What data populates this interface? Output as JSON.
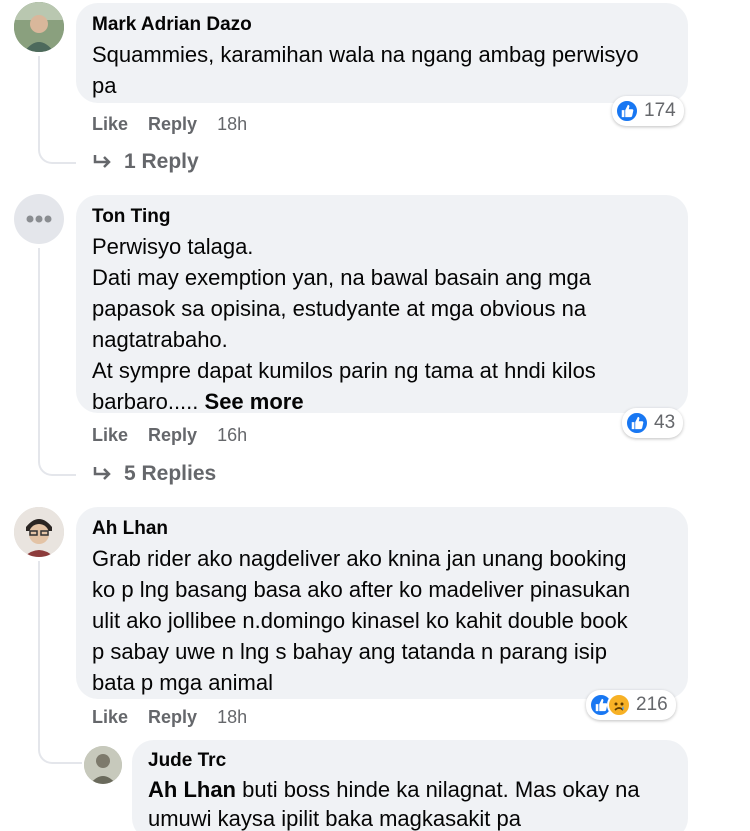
{
  "comments": [
    {
      "author": "Mark Adrian Dazo",
      "text": "Squammies, karamihan wala na ngang ambag perwisyo\npa",
      "reactions": {
        "icons": [
          "like-icon"
        ],
        "count": "174"
      },
      "actions": {
        "like": "Like",
        "reply": "Reply",
        "time": "18h"
      },
      "replies_label": "1 Reply"
    },
    {
      "author": "Ton Ting",
      "text": "Perwisyo talaga.\nDati may exemption yan, na bawal basain ang mga\npapasok sa opisina, estudyante at mga obvious na\nnagtatrabaho.\nAt sympre dapat kumilos parin ng tama at hndi kilos\nbarbaro..... ",
      "see_more": "See more",
      "reactions": {
        "icons": [
          "like-icon"
        ],
        "count": "43"
      },
      "actions": {
        "like": "Like",
        "reply": "Reply",
        "time": "16h"
      },
      "replies_label": "5 Replies"
    },
    {
      "author": "Ah Lhan",
      "text": "Grab rider ako nagdeliver ako knina jan unang booking\nko p lng basang basa ako after ko madeliver pinasukan\nulit ako jollibee n.domingo kinasel ko kahit double book\np sabay uwe n lng s bahay ang tatanda n parang isip\nbata p mga animal",
      "reactions": {
        "icons": [
          "like-icon",
          "sad-icon"
        ],
        "count": "216"
      },
      "actions": {
        "like": "Like",
        "reply": "Reply",
        "time": "18h"
      }
    }
  ],
  "reply": {
    "author": "Jude Trc",
    "mention": "Ah Lhan",
    "text": " buti boss hinde ka nilagnat. Mas okay na\numuwi kaysa ipilit baka magkasakit pa"
  },
  "colors": {
    "bubble": "#f0f2f5",
    "like_blue": "#1877f2",
    "muted": "#65676b",
    "sad_yellow": "#f7b125"
  }
}
